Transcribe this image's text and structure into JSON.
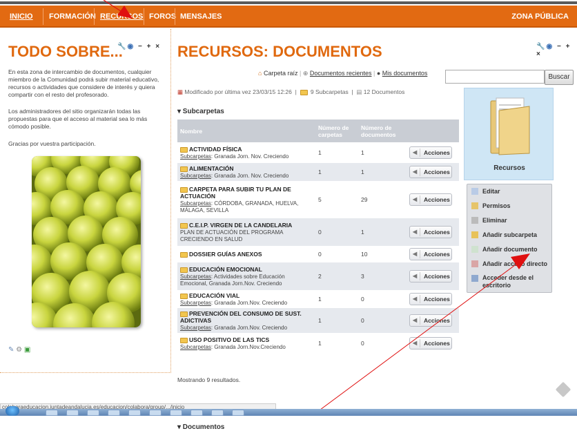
{
  "nav": {
    "inicio": "INICIO",
    "formacion": "FORMACIÓN",
    "recursos": "RECURSOS",
    "foros": "FOROS",
    "mensajes": "MENSAJES",
    "zona": "ZONA PÚBLICA"
  },
  "left": {
    "title": "TODO SOBRE...",
    "para1": "En esta zona de intercambio de documentos, cualquier miembro de la Comunidad podrá subir material educativo, recursos o actividades que considere de interés y quiera compartir con el resto del profesorado.",
    "para2": "Los administradores del sitio organizarán todas las propuestas para que el acceso al material sea lo más cómodo posible.",
    "para3": "Gracias por vuestra participación.",
    "controls": "− + ×"
  },
  "main": {
    "title": "RECURSOS: DOCUMENTOS",
    "controls": "− + ×",
    "carpeta_raiz": "Carpeta raíz",
    "docs_recientes": "Documentos recientes",
    "mis_docs": "Mis documentos",
    "search_btn": "Buscar",
    "modificado": "Modificado por última vez 23/03/15 12:26",
    "subcarpetas_count": "9 Subcarpetas",
    "documentos_count": "12 Documentos",
    "subcarpetas_header": "▾ Subcarpetas",
    "col_nombre": "Nombre",
    "col_carpetas": "Número de carpetas",
    "col_documentos": "Número de documentos",
    "acciones": "Acciones",
    "mostrando": "Mostrando 9 resultados.",
    "documentos_header": "▾ Documentos"
  },
  "rows": [
    {
      "name": "ACTIVIDAD FÍSICA",
      "sublabel": "Subcarpetas",
      "sub": ": Granada Jorn. Nov. Creciendo",
      "carpetas": "1",
      "documentos": "1"
    },
    {
      "name": "ALIMENTACIÓN",
      "sublabel": "Subcarpetas",
      "sub": ": Granada Jorn. Nov. Creciendo",
      "carpetas": "1",
      "documentos": "1"
    },
    {
      "name": "CARPETA PARA SUBIR TU PLAN DE ACTUACIÓN",
      "sublabel": "Subcarpetas",
      "sub": ": CÓRDOBA, GRANADA, HUELVA, MÁLAGA, SEVILLA",
      "carpetas": "5",
      "documentos": "29"
    },
    {
      "name": "C.E.I.P. VIRGEN DE LA CANDELARIA",
      "sublabel": "",
      "sub": "PLAN DE ACTUACIÓN DEL PROGRAMA CRECIENDO EN SALUD",
      "carpetas": "0",
      "documentos": "1"
    },
    {
      "name": "DOSSIER GUÍAS ANEXOS",
      "sublabel": "",
      "sub": "",
      "carpetas": "0",
      "documentos": "10"
    },
    {
      "name": "EDUCACIÓN EMOCIONAL",
      "sublabel": "Subcarpetas",
      "sub": ": Actividades sobre Educación Emocional, Granada Jorn.Nov. Creciendo",
      "carpetas": "2",
      "documentos": "3"
    },
    {
      "name": "EDUCACIÓN VIAL",
      "sublabel": "Subcarpetas",
      "sub": ": Granada Jorn.Nov. Creciendo",
      "carpetas": "1",
      "documentos": "0"
    },
    {
      "name": "PREVENCIÓN DEL CONSUMO DE SUST. ADICTIVAS",
      "sublabel": "Subcarpetas",
      "sub": ": Granada Jorn.Nov. Creciendo",
      "carpetas": "1",
      "documentos": "0"
    },
    {
      "name": "USO POSITIVO DE LAS TICS",
      "sublabel": "Subcarpetas",
      "sub": ": Granada Jorn.Nov.Creciendo",
      "carpetas": "1",
      "documentos": "0"
    }
  ],
  "right": {
    "recursos": "Recursos",
    "menu": [
      "Editar",
      "Permisos",
      "Eliminar",
      "Añadir subcarpeta",
      "Añadir documento",
      "Añadir acceso directo",
      "Acceder desde el escritorio"
    ]
  },
  "status": {
    "url": "colaboraeducacion.juntadeandalucia.es/educacion/colabora/group/.../inicio"
  },
  "colors": {
    "accent": "#e26a12",
    "title": "#e0690f"
  }
}
